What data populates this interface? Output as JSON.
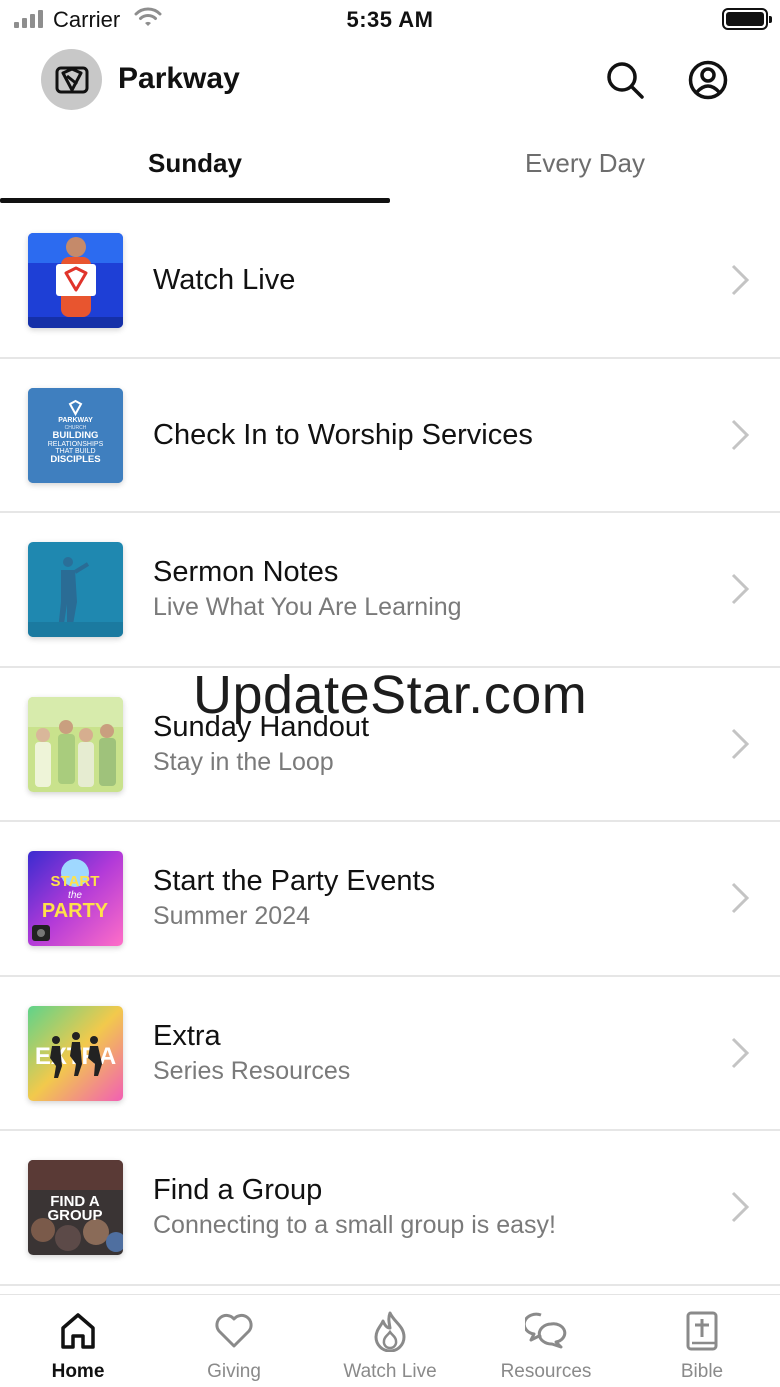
{
  "status_bar": {
    "carrier": "Carrier",
    "time": "5:35 AM",
    "signal_icon": "signal-icon",
    "wifi_icon": "wifi-icon",
    "battery_icon": "battery-icon"
  },
  "header": {
    "title": "Parkway",
    "logo_icon": "parkway-logo-icon",
    "search_icon": "search-icon",
    "profile_icon": "profile-icon"
  },
  "tabs": [
    {
      "label": "Sunday",
      "active": true
    },
    {
      "label": "Every Day",
      "active": false
    }
  ],
  "items": [
    {
      "title": "Watch Live",
      "subtitle": ""
    },
    {
      "title": "Check In to Worship Services",
      "subtitle": ""
    },
    {
      "title": "Sermon Notes",
      "subtitle": "Live What You Are Learning"
    },
    {
      "title": "Sunday Handout",
      "subtitle": "Stay in the Loop"
    },
    {
      "title": "Start the Party Events",
      "subtitle": "Summer 2024"
    },
    {
      "title": "Extra",
      "subtitle": "Series Resources"
    },
    {
      "title": "Find a Group",
      "subtitle": "Connecting to a small group is easy!"
    }
  ],
  "thumbnails": {
    "checkin_text": [
      "PARKWAY",
      "CHURCH",
      "BUILDING",
      "RELATIONSHIPS",
      "THAT BUILD",
      "DISCIPLES"
    ],
    "party_text": [
      "START",
      "the",
      "PARTY"
    ],
    "extra_text": "EXTRA",
    "group_text": [
      "FIND A",
      "GROUP"
    ]
  },
  "watermark": "UpdateStar.com",
  "bottom_nav": [
    {
      "label": "Home",
      "icon": "home-icon",
      "active": true
    },
    {
      "label": "Giving",
      "icon": "heart-icon",
      "active": false
    },
    {
      "label": "Watch Live",
      "icon": "flame-icon",
      "active": false
    },
    {
      "label": "Resources",
      "icon": "chat-bubbles-icon",
      "active": false
    },
    {
      "label": "Bible",
      "icon": "bible-icon",
      "active": false
    }
  ],
  "colors": {
    "active_text": "#111111",
    "inactive_text": "#8a8a8a",
    "divider": "#e6e6e6",
    "thumb_watch_live": "#1e3fd6",
    "thumb_checkin": "#3f7fbf",
    "thumb_sermon": "#1f88b0"
  }
}
